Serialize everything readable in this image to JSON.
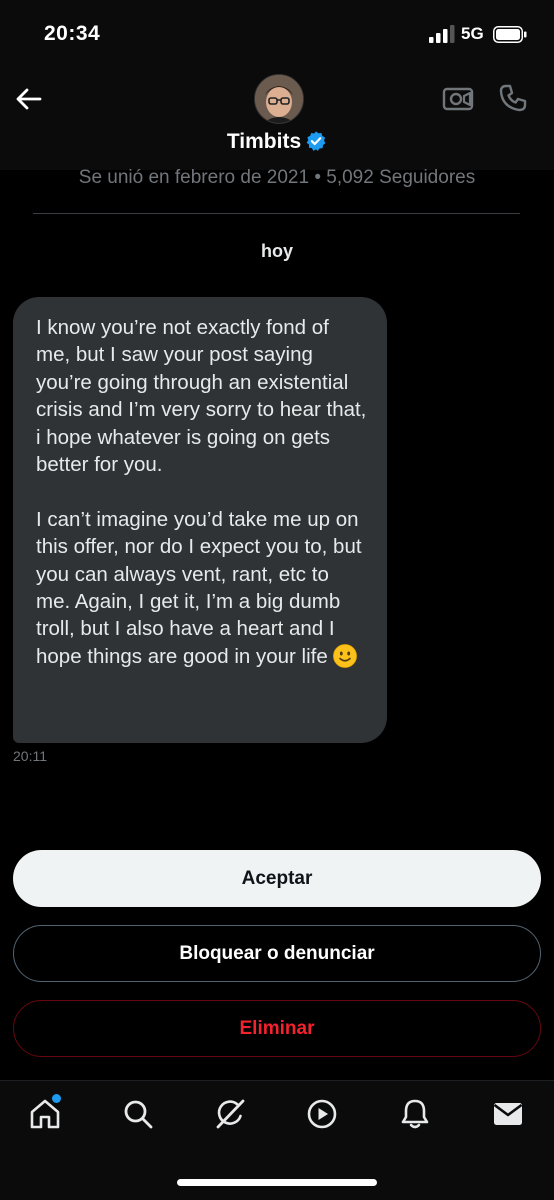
{
  "status_bar": {
    "time": "20:34",
    "network": "5G"
  },
  "header": {
    "back_icon": "arrow-left-icon",
    "video_icon": "video-call-icon",
    "phone_icon": "phone-icon",
    "name": "Timbits",
    "verified_icon": "verified-badge-icon",
    "verified_color": "#1d9bf0",
    "meta": "Se unió en febrero de 2021 • 5,092 Seguidores"
  },
  "conversation": {
    "date_separator": "hoy",
    "message": {
      "text": "I know you’re not exactly fond of me, but I saw your post saying you’re going through an existential crisis and I’m very sorry to hear that, i hope whatever is going on gets better for you.\n\nI can’t imagine you’d take me up on this offer, nor do I expect you to, but you can always vent, rant, etc to me. Again, I get it, I’m a big dumb troll, but I also have a heart and I hope things are good in your life",
      "emoji": "🙂",
      "time": "20:11"
    }
  },
  "actions": {
    "accept_label": "Aceptar",
    "block_label": "Bloquear o denunciar",
    "delete_label": "Eliminar",
    "delete_color": "#f4212e"
  },
  "tab_bar": {
    "items": [
      "home-icon",
      "search-icon",
      "grok-icon",
      "video-play-icon",
      "notifications-bell-icon",
      "messages-envelope-icon"
    ],
    "notification_dot_color": "#1d9bf0"
  }
}
